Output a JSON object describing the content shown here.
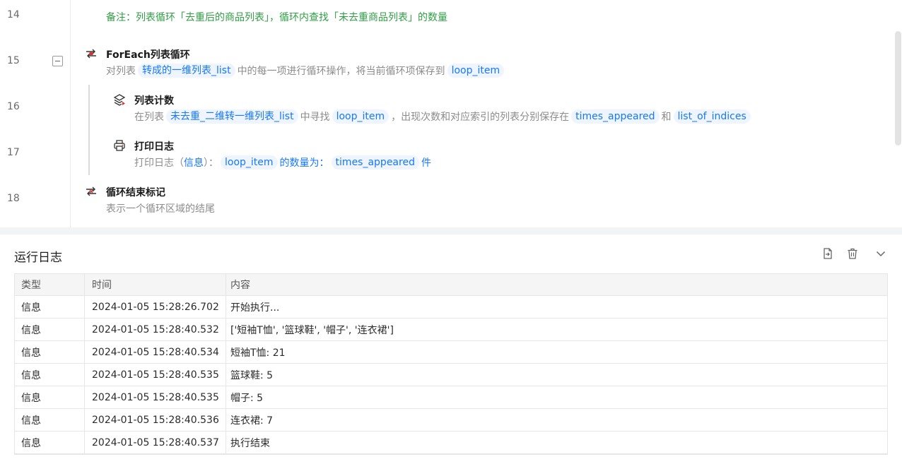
{
  "editor": {
    "line_numbers": [
      "14",
      "15",
      "16",
      "17",
      "18"
    ],
    "note": "备注：列表循环「去重后的商品列表」，循环内查找「未去重商品列表」的数量",
    "foreach": {
      "title": "ForEach列表循环",
      "desc_prefix": "对列表",
      "list_var": "转成的一维列表_list",
      "desc_middle": "中的每一项进行循环操作，将当前循环项保存到",
      "item_var": "loop_item"
    },
    "list_count": {
      "title": "列表计数",
      "desc_prefix": "在列表",
      "list_var": "未去重_二维转一维列表_list",
      "desc_find": "中寻找",
      "item_var": "loop_item",
      "desc_middle": "，出现次数和对应索引的列表分别保存在",
      "times_var": "times_appeared",
      "desc_and": "和",
      "indices_var": "list_of_indices"
    },
    "print_log": {
      "title": "打印日志",
      "desc_prefix": "打印日志（",
      "level": "信息",
      "desc_colon": "）：",
      "item_var": "loop_item",
      "text_mid": "的数量为：",
      "times_var": "times_appeared",
      "text_end": "件"
    },
    "loop_end": {
      "title": "循环结束标记",
      "desc": "表示一个循环区域的结尾"
    }
  },
  "log_panel": {
    "title": "运行日志",
    "icons": [
      "export-icon",
      "trash-icon",
      "chevron-down-icon"
    ],
    "columns": [
      "类型",
      "时间",
      "内容"
    ],
    "rows": [
      {
        "type": "信息",
        "time": "2024-01-05 15:28:26.702",
        "content": "开始执行..."
      },
      {
        "type": "信息",
        "time": "2024-01-05 15:28:40.532",
        "content": "['短袖T恤', '篮球鞋', '帽子', '连衣裙']"
      },
      {
        "type": "信息",
        "time": "2024-01-05 15:28:40.534",
        "content": "短袖T恤: 21"
      },
      {
        "type": "信息",
        "time": "2024-01-05 15:28:40.535",
        "content": "篮球鞋: 5"
      },
      {
        "type": "信息",
        "time": "2024-01-05 15:28:40.535",
        "content": "帽子: 5"
      },
      {
        "type": "信息",
        "time": "2024-01-05 15:28:40.536",
        "content": "连衣裙: 7"
      },
      {
        "type": "信息",
        "time": "2024-01-05 15:28:40.537",
        "content": "执行结束"
      }
    ]
  },
  "colors": {
    "accent": "#1677ff",
    "chip_bg": "#eef5ff",
    "note_green": "#2f9e44",
    "icon_red": "#e03131"
  }
}
